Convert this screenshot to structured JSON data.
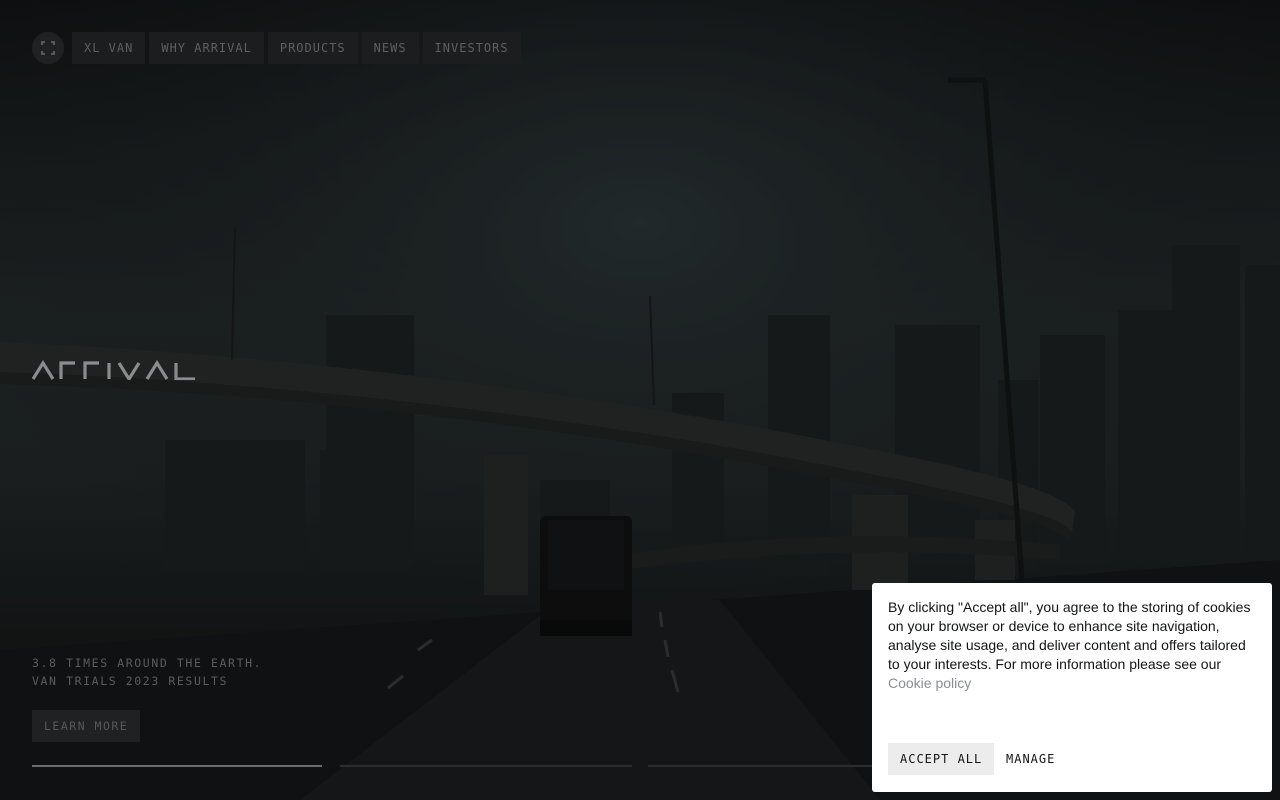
{
  "nav": {
    "menu_icon": "grid-expand-icon",
    "items": [
      "XL VAN",
      "WHY ARRIVAL",
      "PRODUCTS",
      "NEWS",
      "INVESTORS"
    ]
  },
  "brand": {
    "logo_text": "ARRIVAL"
  },
  "hero": {
    "tagline_line1": "3.8 TIMES AROUND THE EARTH.",
    "tagline_line2": "VAN TRIALS 2023 RESULTS",
    "cta_label": "LEARN MORE",
    "slides": [
      {
        "progress": 1.0
      },
      {
        "progress": 0.0
      },
      {
        "progress": 0.0
      },
      {
        "progress": 0.0
      }
    ]
  },
  "cookie": {
    "text": "By clicking \"Accept all\", you agree to the storing of cookies on your browser or device to enhance site navigation, analyse site usage, and deliver content and offers tailored to your interests. For more information please see our ",
    "link_text": "Cookie policy",
    "accept_label": "ACCEPT ALL",
    "manage_label": "MANAGE"
  },
  "colors": {
    "background": "#0d0e0f",
    "cookie_bg": "#ffffff",
    "accept_bg": "#ececec",
    "link": "#8b8e90"
  }
}
